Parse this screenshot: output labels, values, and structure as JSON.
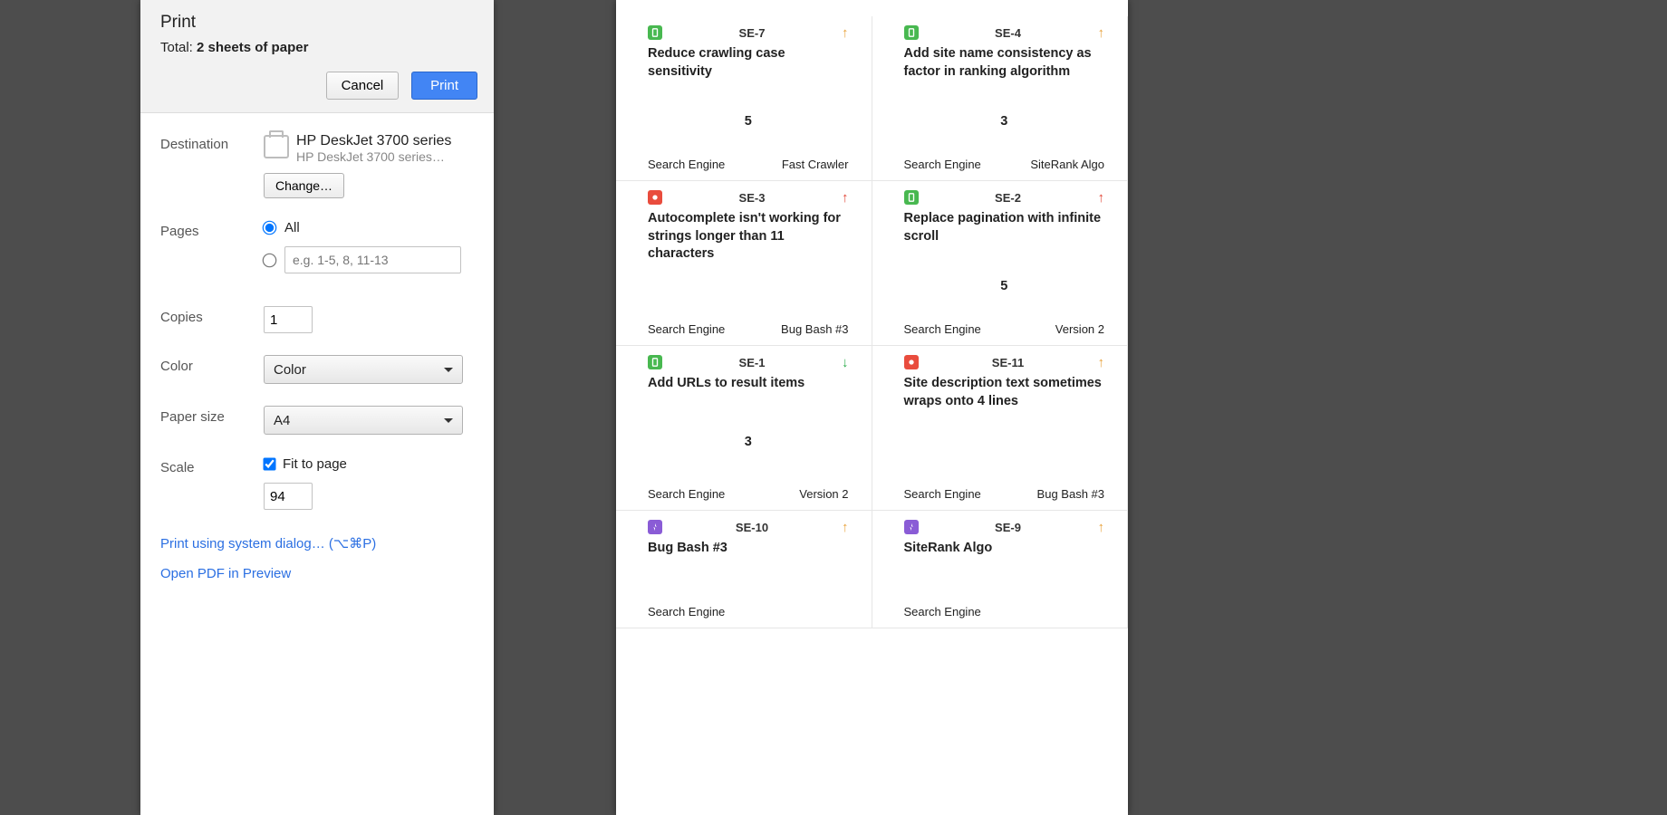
{
  "print": {
    "title": "Print",
    "total_prefix": "Total: ",
    "total_value": "2 sheets of paper",
    "cancel": "Cancel",
    "submit": "Print",
    "destination_label": "Destination",
    "destination_name": "HP DeskJet 3700 series",
    "destination_sub": "HP DeskJet 3700 series…",
    "change": "Change…",
    "pages_label": "Pages",
    "pages_all": "All",
    "pages_range_placeholder": "e.g. 1-5, 8, 11-13",
    "copies_label": "Copies",
    "copies_value": "1",
    "color_label": "Color",
    "color_value": "Color",
    "paper_label": "Paper size",
    "paper_value": "A4",
    "scale_label": "Scale",
    "scale_fit": "Fit to page",
    "scale_value": "94",
    "system_dialog": "Print using system dialog… (⌥⌘P)",
    "open_preview": "Open PDF in Preview"
  },
  "cards": [
    {
      "type": "story",
      "id": "SE-7",
      "prio": "med",
      "title": "Reduce crawling case sensitivity",
      "points": "5",
      "left": "Search Engine",
      "right": "Fast Crawler"
    },
    {
      "type": "story",
      "id": "SE-4",
      "prio": "med",
      "title": "Add site name consistency as factor in ranking algorithm",
      "points": "3",
      "left": "Search Engine",
      "right": "SiteRank Algo"
    },
    {
      "type": "bug",
      "id": "SE-3",
      "prio": "high",
      "title": "Autocomplete isn't working for strings longer than 11 characters",
      "points": "",
      "left": "Search Engine",
      "right": "Bug Bash #3"
    },
    {
      "type": "story",
      "id": "SE-2",
      "prio": "high",
      "title": "Replace pagination with infinite scroll",
      "points": "5",
      "left": "Search Engine",
      "right": "Version 2"
    },
    {
      "type": "story",
      "id": "SE-1",
      "prio": "low",
      "title": "Add URLs to result items",
      "points": "3",
      "left": "Search Engine",
      "right": "Version 2"
    },
    {
      "type": "bug",
      "id": "SE-11",
      "prio": "med",
      "title": "Site description text sometimes wraps onto 4 lines",
      "points": "",
      "left": "Search Engine",
      "right": "Bug Bash #3"
    },
    {
      "type": "epic",
      "id": "SE-10",
      "prio": "med",
      "title": "Bug Bash #3",
      "points": "",
      "left": "Search Engine",
      "right": ""
    },
    {
      "type": "epic",
      "id": "SE-9",
      "prio": "med",
      "title": "SiteRank Algo",
      "points": "",
      "left": "Search Engine",
      "right": ""
    }
  ]
}
